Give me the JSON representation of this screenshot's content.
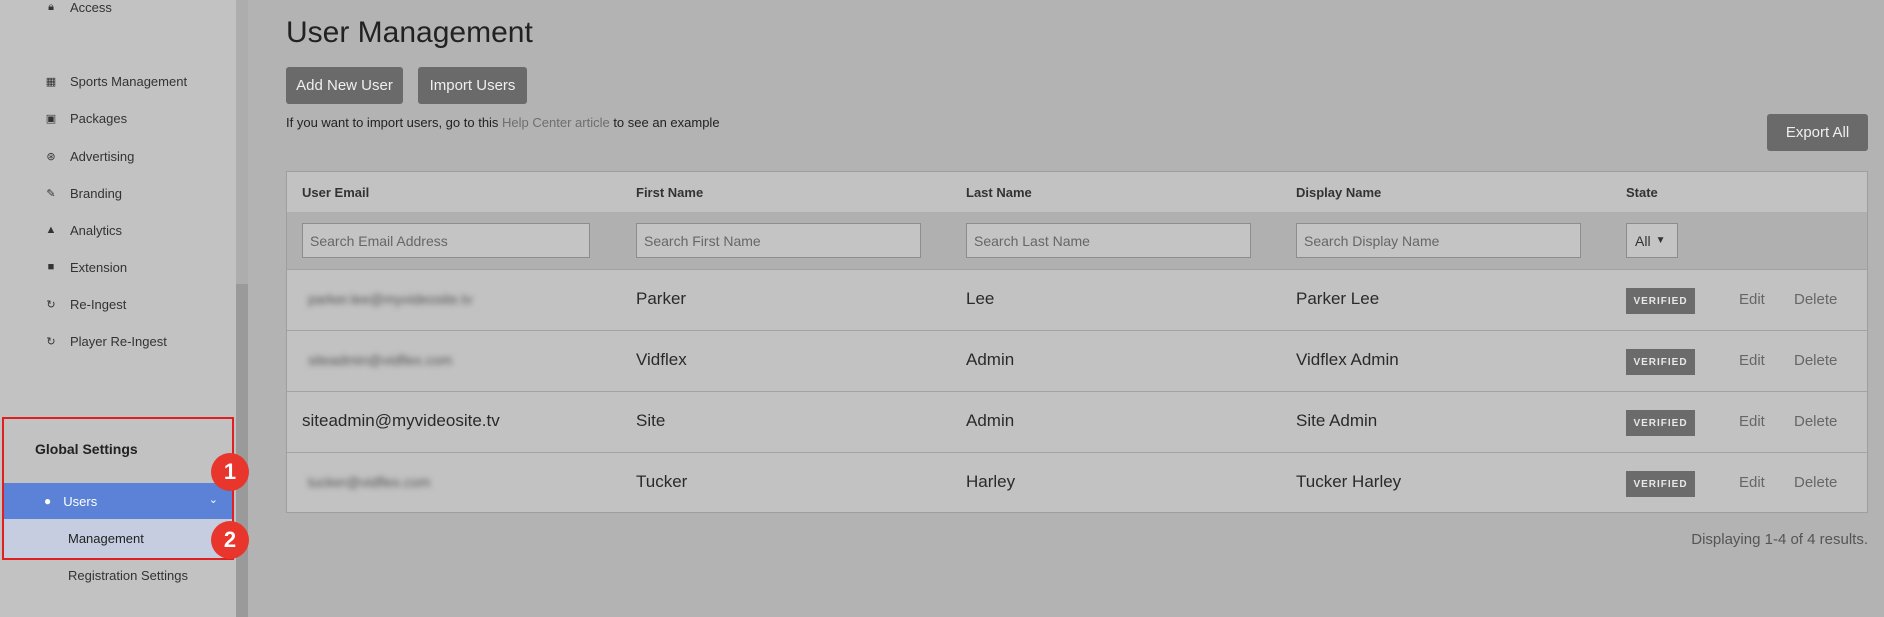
{
  "sidebar": {
    "top_item": {
      "label": "Access",
      "icon": "lock-icon"
    },
    "items": [
      {
        "label": "Sports Management",
        "icon": "calendar-icon"
      },
      {
        "label": "Packages",
        "icon": "money-icon"
      },
      {
        "label": "Advertising",
        "icon": "handshake-icon"
      },
      {
        "label": "Branding",
        "icon": "brush-icon"
      },
      {
        "label": "Analytics",
        "icon": "area-chart-icon"
      },
      {
        "label": "Extension",
        "icon": "briefcase-icon"
      },
      {
        "label": "Re-Ingest",
        "icon": "refresh-icon"
      },
      {
        "label": "Player Re-Ingest",
        "icon": "refresh-icon"
      }
    ],
    "global_settings": {
      "title": "Global Settings",
      "users_label": "Users",
      "management_label": "Management",
      "registration_label": "Registration Settings"
    }
  },
  "annotations": {
    "step1": "1",
    "step2": "2"
  },
  "main": {
    "title": "User Management",
    "add_button": "Add New User",
    "import_button": "Import Users",
    "export_button": "Export All",
    "help": {
      "prefix": "If you want to import users, go to this ",
      "link": "Help Center article",
      "suffix": " to see an example"
    },
    "table": {
      "headers": {
        "email": "User Email",
        "first": "First Name",
        "last": "Last Name",
        "display": "Display Name",
        "state": "State"
      },
      "placeholders": {
        "email": "Search Email Address",
        "first": "Search First Name",
        "last": "Search Last Name",
        "display": "Search Display Name"
      },
      "state_filter": "All",
      "rows": [
        {
          "email": "parker.lee@myvideosite.tv",
          "first": "Parker",
          "last": "Lee",
          "display": "Parker Lee",
          "state": "VERIFIED",
          "edit": "Edit",
          "delete": "Delete"
        },
        {
          "email": "siteadmin@vidflex.com",
          "first": "Vidflex",
          "last": "Admin",
          "display": "Vidflex Admin",
          "state": "VERIFIED",
          "edit": "Edit",
          "delete": "Delete"
        },
        {
          "email": "siteadmin@myvideosite.tv",
          "first": "Site",
          "last": "Admin",
          "display": "Site Admin",
          "state": "VERIFIED",
          "edit": "Edit",
          "delete": "Delete"
        },
        {
          "email": "tucker@vidflex.com",
          "first": "Tucker",
          "last": "Harley",
          "display": "Tucker Harley",
          "state": "VERIFIED",
          "edit": "Edit",
          "delete": "Delete"
        }
      ]
    },
    "footer": "Displaying 1-4 of 4 results."
  }
}
